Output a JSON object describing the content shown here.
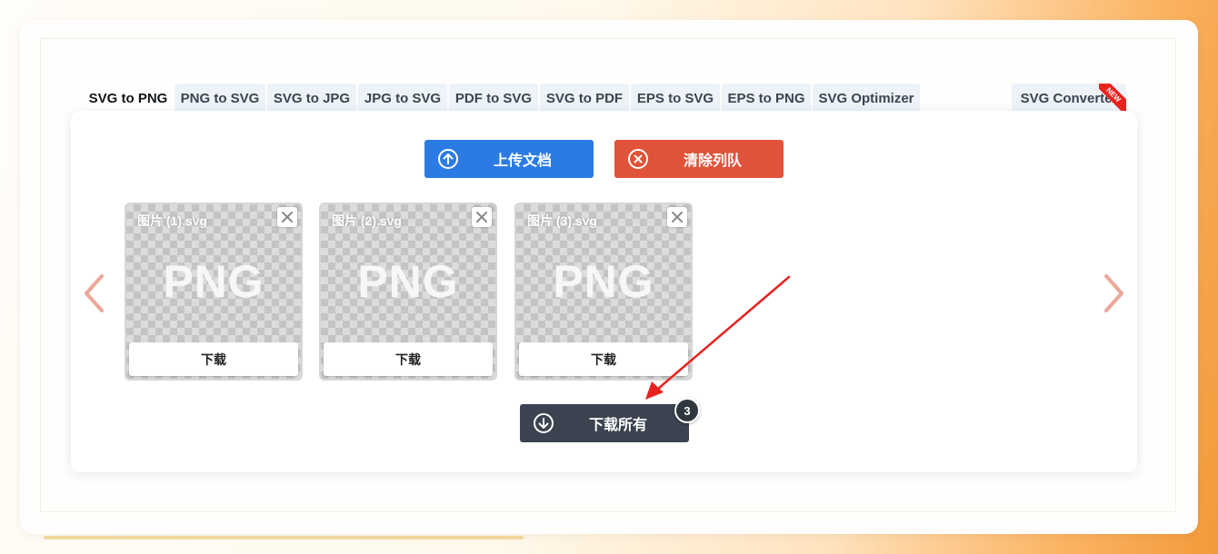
{
  "tabs": [
    {
      "label": "SVG to PNG",
      "active": true
    },
    {
      "label": "PNG to SVG"
    },
    {
      "label": "SVG to JPG"
    },
    {
      "label": "JPG to SVG"
    },
    {
      "label": "PDF to SVG"
    },
    {
      "label": "SVG to PDF"
    },
    {
      "label": "EPS to SVG"
    },
    {
      "label": "EPS to PNG"
    },
    {
      "label": "SVG Optimizer"
    },
    {
      "label": "SVG Converter",
      "badge": "NEW"
    }
  ],
  "toolbar": {
    "upload_label": "上传文档",
    "clear_label": "清除列队"
  },
  "files": [
    {
      "name": "图片 (1).svg",
      "format": "PNG",
      "download_label": "下载"
    },
    {
      "name": "图片 (2).svg",
      "format": "PNG",
      "download_label": "下载"
    },
    {
      "name": "图片 (3).svg",
      "format": "PNG",
      "download_label": "下载"
    }
  ],
  "download_all": {
    "label": "下载所有",
    "count": "3"
  },
  "colors": {
    "upload": "#2c7be5",
    "clear": "#e05339",
    "download_all": "#3b4350",
    "new_badge": "#e8231f",
    "arrow": "#e8231f"
  }
}
